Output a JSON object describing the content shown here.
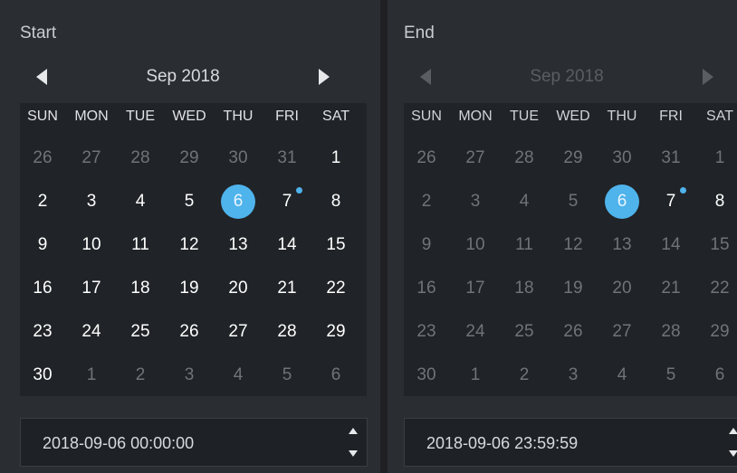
{
  "colors": {
    "accent": "#4fb3ec",
    "panel": "#2a2d32",
    "grid": "#202327"
  },
  "start": {
    "label": "Start",
    "month_title": "Sep 2018",
    "disabled": false,
    "weekdays": [
      "SUN",
      "MON",
      "TUE",
      "WED",
      "THU",
      "FRI",
      "SAT"
    ],
    "weeks": [
      [
        {
          "d": "26",
          "m": true
        },
        {
          "d": "27",
          "m": true
        },
        {
          "d": "28",
          "m": true
        },
        {
          "d": "29",
          "m": true
        },
        {
          "d": "30",
          "m": true
        },
        {
          "d": "31",
          "m": true
        },
        {
          "d": "1"
        }
      ],
      [
        {
          "d": "2"
        },
        {
          "d": "3"
        },
        {
          "d": "4"
        },
        {
          "d": "5"
        },
        {
          "d": "6",
          "sel": true
        },
        {
          "d": "7",
          "dot": true
        },
        {
          "d": "8"
        }
      ],
      [
        {
          "d": "9"
        },
        {
          "d": "10"
        },
        {
          "d": "11"
        },
        {
          "d": "12"
        },
        {
          "d": "13"
        },
        {
          "d": "14"
        },
        {
          "d": "15"
        }
      ],
      [
        {
          "d": "16"
        },
        {
          "d": "17"
        },
        {
          "d": "18"
        },
        {
          "d": "19"
        },
        {
          "d": "20"
        },
        {
          "d": "21"
        },
        {
          "d": "22"
        }
      ],
      [
        {
          "d": "23"
        },
        {
          "d": "24"
        },
        {
          "d": "25"
        },
        {
          "d": "26"
        },
        {
          "d": "27"
        },
        {
          "d": "28"
        },
        {
          "d": "29"
        }
      ],
      [
        {
          "d": "30"
        },
        {
          "d": "1",
          "m": true
        },
        {
          "d": "2",
          "m": true
        },
        {
          "d": "3",
          "m": true
        },
        {
          "d": "4",
          "m": true
        },
        {
          "d": "5",
          "m": true
        },
        {
          "d": "6",
          "m": true
        }
      ]
    ],
    "time_value": "2018-09-06 00:00:00"
  },
  "end": {
    "label": "End",
    "month_title": "Sep 2018",
    "disabled": true,
    "weekdays": [
      "SUN",
      "MON",
      "TUE",
      "WED",
      "THU",
      "FRI",
      "SAT"
    ],
    "weeks": [
      [
        {
          "d": "26",
          "m": true
        },
        {
          "d": "27",
          "m": true
        },
        {
          "d": "28",
          "m": true
        },
        {
          "d": "29",
          "m": true
        },
        {
          "d": "30",
          "m": true
        },
        {
          "d": "31",
          "m": true
        },
        {
          "d": "1"
        }
      ],
      [
        {
          "d": "2"
        },
        {
          "d": "3"
        },
        {
          "d": "4"
        },
        {
          "d": "5"
        },
        {
          "d": "6",
          "sel": true
        },
        {
          "d": "7",
          "dot": true,
          "bright": true
        },
        {
          "d": "8",
          "bright": true
        }
      ],
      [
        {
          "d": "9"
        },
        {
          "d": "10"
        },
        {
          "d": "11"
        },
        {
          "d": "12"
        },
        {
          "d": "13"
        },
        {
          "d": "14"
        },
        {
          "d": "15"
        }
      ],
      [
        {
          "d": "16"
        },
        {
          "d": "17"
        },
        {
          "d": "18"
        },
        {
          "d": "19"
        },
        {
          "d": "20"
        },
        {
          "d": "21"
        },
        {
          "d": "22"
        }
      ],
      [
        {
          "d": "23"
        },
        {
          "d": "24"
        },
        {
          "d": "25"
        },
        {
          "d": "26"
        },
        {
          "d": "27"
        },
        {
          "d": "28"
        },
        {
          "d": "29"
        }
      ],
      [
        {
          "d": "30"
        },
        {
          "d": "1",
          "m": true
        },
        {
          "d": "2",
          "m": true
        },
        {
          "d": "3",
          "m": true
        },
        {
          "d": "4",
          "m": true
        },
        {
          "d": "5",
          "m": true
        },
        {
          "d": "6",
          "m": true
        }
      ]
    ],
    "time_value": "2018-09-06 23:59:59"
  }
}
